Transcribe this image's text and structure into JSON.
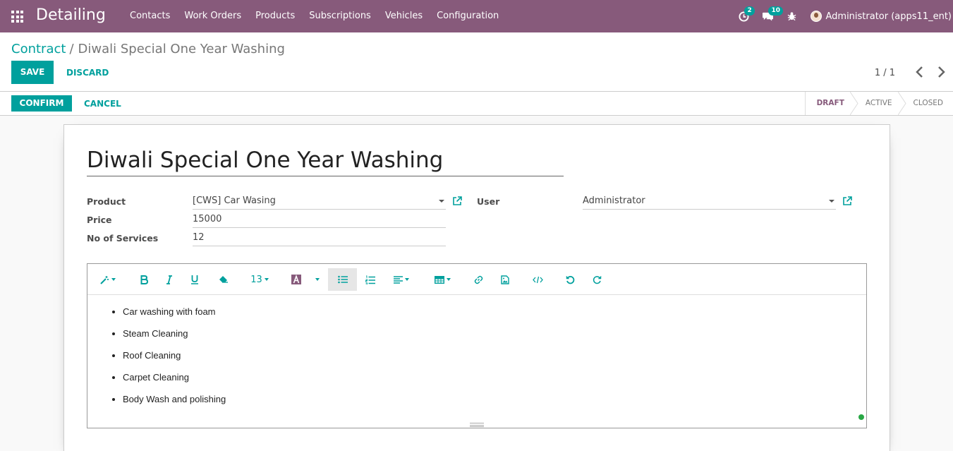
{
  "navbar": {
    "app_title": "Detailing",
    "menu": [
      "Contacts",
      "Work Orders",
      "Products",
      "Subscriptions",
      "Vehicles",
      "Configuration"
    ],
    "activity_badge": "2",
    "messages_badge": "10",
    "user_label": "Administrator (apps11_ent)"
  },
  "control_panel": {
    "breadcrumb_parent": "Contract",
    "breadcrumb_separator": "/",
    "breadcrumb_current": "Diwali Special One Year Washing",
    "save_label": "SAVE",
    "discard_label": "DISCARD",
    "pager": "1 / 1"
  },
  "statusbar": {
    "confirm_label": "CONFIRM",
    "cancel_label": "CANCEL",
    "steps": [
      "DRAFT",
      "ACTIVE",
      "CLOSED"
    ],
    "active_step": "DRAFT"
  },
  "form": {
    "title": "Diwali Special One Year Washing",
    "product_label": "Product",
    "product_value": "[CWS] Car Wasing",
    "price_label": "Price",
    "price_value": "15000",
    "services_label": "No of Services",
    "services_value": "12",
    "user_label": "User",
    "user_value": "Administrator"
  },
  "editor": {
    "font_size": "13",
    "items": [
      "Car washing with foam",
      "Steam Cleaning",
      "Roof Cleaning",
      "Carpet Cleaning",
      "Body Wash and polishing"
    ]
  },
  "colors": {
    "brand": "#875a7b",
    "accent": "#00a09d"
  }
}
